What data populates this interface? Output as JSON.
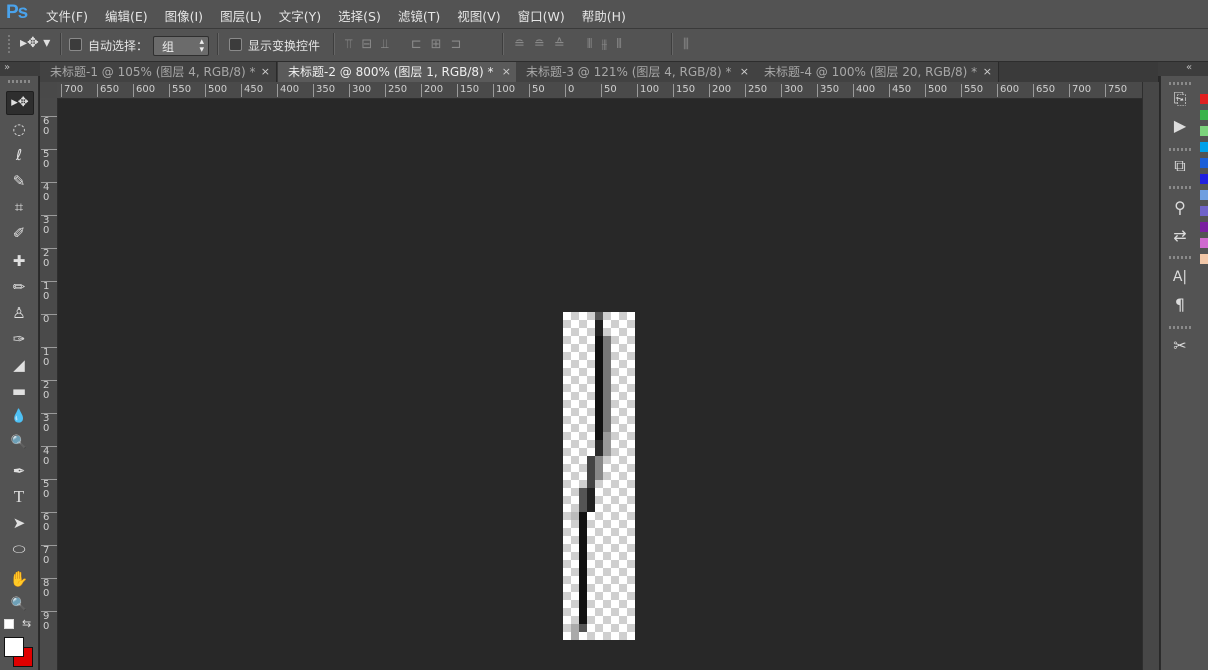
{
  "app": {
    "logo": "Ps"
  },
  "menu": [
    "文件(F)",
    "编辑(E)",
    "图像(I)",
    "图层(L)",
    "文字(Y)",
    "选择(S)",
    "滤镜(T)",
    "视图(V)",
    "窗口(W)",
    "帮助(H)"
  ],
  "options": {
    "auto_select_label": "自动选择：",
    "auto_select_checked": false,
    "auto_select_target": "组",
    "show_transform_label": "显示变换控件",
    "show_transform_checked": false
  },
  "tabs": [
    {
      "label": "未标题-1 @ 105% (图层 4, RGB/8) *",
      "active": false
    },
    {
      "label": "未标题-2 @ 800% (图层 1, RGB/8) *",
      "active": true
    },
    {
      "label": "未标题-3 @ 121% (图层 4, RGB/8) *",
      "active": false
    },
    {
      "label": "未标题-4 @ 100% (图层 20, RGB/8) *",
      "active": false
    }
  ],
  "tab_close": "×",
  "collapse_left": "»",
  "collapse_right": "«",
  "ruler": {
    "h_ticks": [
      "700",
      "650",
      "600",
      "550",
      "500",
      "450",
      "400",
      "350",
      "300",
      "250",
      "200",
      "150",
      "100",
      "50",
      "0",
      "50",
      "100",
      "150",
      "200",
      "250",
      "300",
      "350",
      "400",
      "450",
      "500",
      "550",
      "600",
      "650",
      "700",
      "750"
    ],
    "v_ticks": [
      [
        "6",
        "0"
      ],
      [
        "5",
        "0"
      ],
      [
        "4",
        "0"
      ],
      [
        "3",
        "0"
      ],
      [
        "2",
        "0"
      ],
      [
        "1",
        "0"
      ],
      [
        "0",
        ""
      ],
      [
        "1",
        "0"
      ],
      [
        "2",
        "0"
      ],
      [
        "3",
        "0"
      ],
      [
        "4",
        "0"
      ],
      [
        "5",
        "0"
      ],
      [
        "6",
        "0"
      ],
      [
        "7",
        "0"
      ],
      [
        "8",
        "0"
      ],
      [
        "9",
        "0"
      ]
    ]
  },
  "tools": [
    "move-tool",
    "marquee-tool",
    "lasso-tool",
    "quick-select-tool",
    "crop-tool",
    "eyedropper-tool",
    "healing-tool",
    "brush-tool",
    "stamp-tool",
    "history-brush-tool",
    "eraser-tool",
    "gradient-tool",
    "blur-tool",
    "dodge-tool",
    "pen-tool",
    "type-tool",
    "path-select-tool",
    "shape-tool",
    "hand-tool",
    "zoom-tool"
  ],
  "tool_glyphs": [
    "▸✥",
    "◌",
    "ℓ",
    "✎",
    "⌗",
    "✐",
    "✚",
    "✏",
    "♙",
    "✑",
    "◢",
    "▬",
    "💧",
    "🔍",
    "✒",
    "T",
    "➤",
    "⬭",
    "✋",
    "🔍"
  ],
  "colors": {
    "foreground": "#ffffff",
    "background": "#e00000",
    "accent": "#4aa3ec"
  },
  "right_panel_icons": [
    "history-icon",
    "actions-icon",
    "layer-comps-icon",
    "brush-presets-icon",
    "tool-presets-icon",
    "character-icon",
    "paragraph-icon",
    "tools-icon"
  ],
  "right_panel_glyphs": [
    "⎘",
    "▶",
    "⧉",
    "⚲",
    "⇄",
    "A|",
    "¶",
    "✂"
  ],
  "swatches": [
    "#e02020",
    "#39b34a",
    "#7cd37c",
    "#00a0e9",
    "#1c5fd8",
    "#2020e0",
    "#6f9fe0",
    "#6f63c8",
    "#7a1fa0",
    "#d06ad0",
    "#f2c7a8"
  ]
}
